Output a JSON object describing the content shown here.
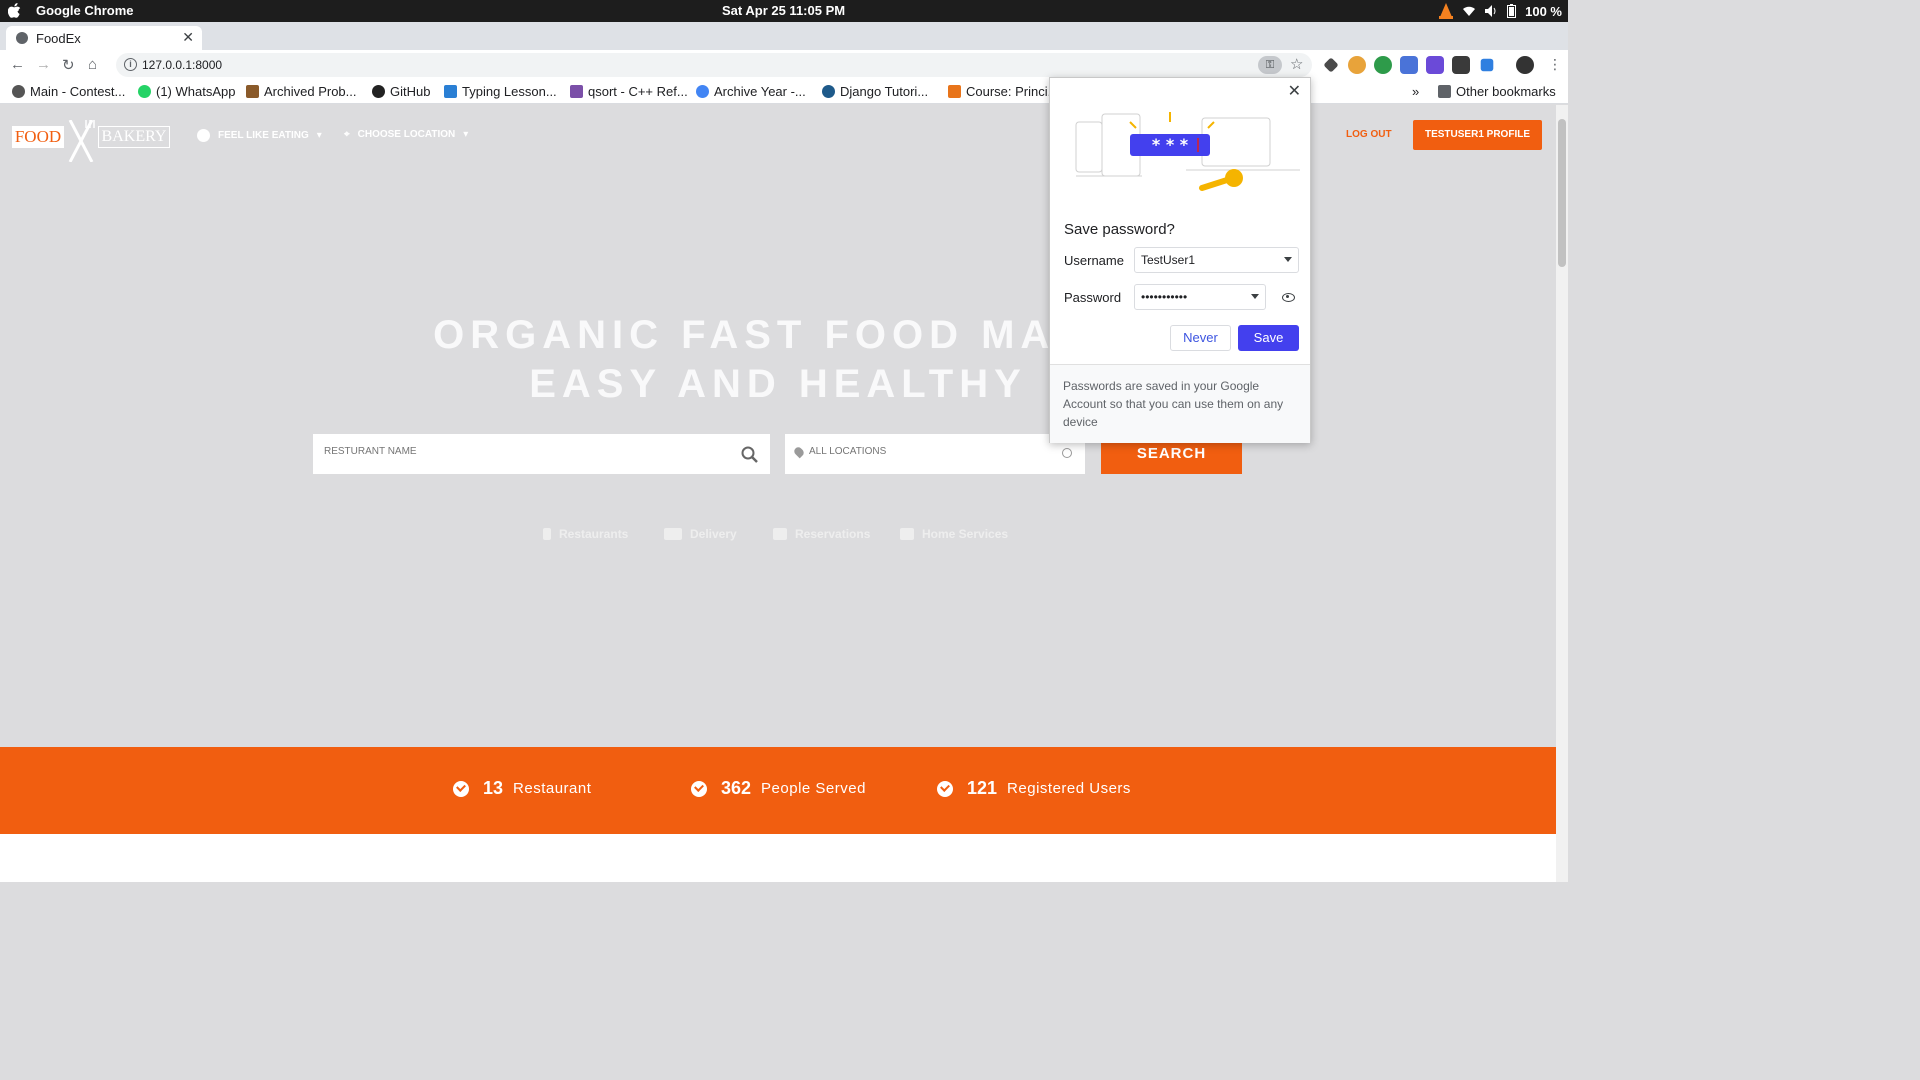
{
  "system_bar": {
    "app_name": "Google Chrome",
    "clock": "Sat Apr 25  11:05 PM",
    "battery": "100 %"
  },
  "browser": {
    "tab_title": "FoodEx",
    "url": "127.0.0.1:8000",
    "bookmarks": [
      {
        "label": "Main - Contest..."
      },
      {
        "label": "(1) WhatsApp"
      },
      {
        "label": "Archived Prob..."
      },
      {
        "label": "GitHub"
      },
      {
        "label": "Typing Lesson..."
      },
      {
        "label": "qsort - C++ Ref..."
      },
      {
        "label": "Archive Year -..."
      },
      {
        "label": "Django Tutori..."
      },
      {
        "label": "Course: Princi..."
      }
    ],
    "other_bookmarks": "Other bookmarks",
    "overflow": "»"
  },
  "site": {
    "logo_food": "FOOD",
    "logo_bakery": "BAKERY",
    "nav": {
      "feel_like_eating": "FEEL LIKE EATING",
      "choose_location": "CHOOSE LOCATION",
      "logout": "LOG OUT",
      "profile": "TESTUSER1 PROFILE"
    },
    "hero_line1": "ORGANIC FAST FOOD MADE",
    "hero_line2": "EASY AND HEALTHY",
    "search": {
      "name_placeholder": "RESTURANT NAME",
      "location_placeholder": "ALL LOCATIONS",
      "button": "SEARCH"
    },
    "categories": [
      "Restaurants",
      "Delivery",
      "Reservations",
      "Home Services"
    ],
    "stats": [
      {
        "number": "13",
        "label": "Restaurant"
      },
      {
        "number": "362",
        "label": "People Served"
      },
      {
        "number": "121",
        "label": "Registered Users"
      }
    ],
    "colors": {
      "accent": "#f15e10",
      "background": "#dcdcde"
    }
  },
  "password_popup": {
    "title": "Save password?",
    "username_label": "Username",
    "username_value": "TestUser1",
    "password_label": "Password",
    "password_value": "•••••••••••",
    "never_button": "Never",
    "save_button": "Save",
    "footer": "Passwords are saved in your Google Account so that you can use them on any device",
    "illustration_text": "* * *"
  }
}
